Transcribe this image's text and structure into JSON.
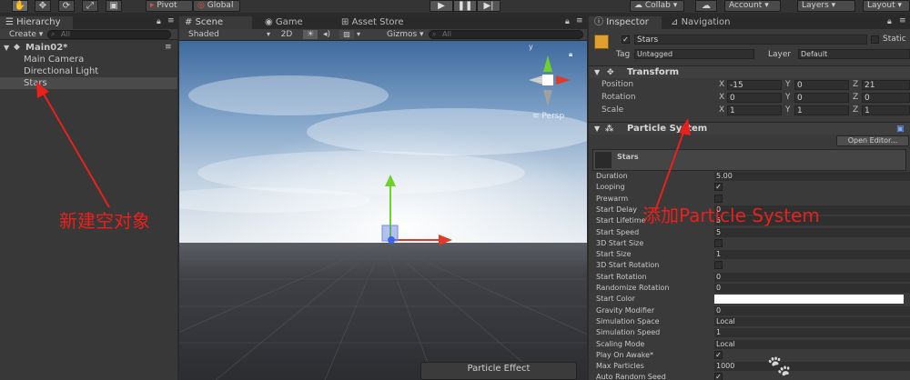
{
  "toolbar": {
    "pivot": "Pivot",
    "global": "Global",
    "collab": "Collab",
    "account": "Account",
    "layers": "Layers",
    "layout": "Layout",
    "hand_icon": "hand-icon",
    "move_icon": "move-icon",
    "rotate_icon": "rotate-icon",
    "scale_icon": "scale-icon",
    "rect_icon": "rect-icon"
  },
  "hierarchy": {
    "tab": "Hierarchy",
    "create": "Create",
    "search_placeholder": "All",
    "scene_name": "Main02*",
    "items": [
      "Main Camera",
      "Directional Light",
      "Stars"
    ],
    "selected": "Stars"
  },
  "scene": {
    "tabs": [
      "Scene",
      "Game",
      "Asset Store"
    ],
    "shading": "Shaded",
    "mode_2d": "2D",
    "gizmos": "Gizmos",
    "search_placeholder": "All",
    "persp_label": "Persp",
    "particle_effect": "Particle Effect"
  },
  "inspector": {
    "tabs": [
      "Inspector",
      "Navigation"
    ],
    "object_name": "Stars",
    "static_label": "Static",
    "tag_label": "Tag",
    "tag_value": "Untagged",
    "layer_label": "Layer",
    "layer_value": "Default",
    "transform": {
      "title": "Transform",
      "position": {
        "label": "Position",
        "x": "-15",
        "y": "0",
        "z": "21"
      },
      "rotation": {
        "label": "Rotation",
        "x": "0",
        "y": "0",
        "z": "0"
      },
      "scale": {
        "label": "Scale",
        "x": "1",
        "y": "1",
        "z": "1"
      }
    },
    "particle_system": {
      "title": "Particle System",
      "open_editor": "Open Editor...",
      "module_name": "Stars",
      "props": [
        {
          "label": "Duration",
          "value": "5.00"
        },
        {
          "label": "Looping",
          "check": true
        },
        {
          "label": "Prewarm",
          "check": false
        },
        {
          "label": "Start Delay",
          "value": "0"
        },
        {
          "label": "Start Lifetime",
          "value": "5"
        },
        {
          "label": "Start Speed",
          "value": "5"
        },
        {
          "label": "3D Start Size",
          "check": false
        },
        {
          "label": "Start Size",
          "value": "1"
        },
        {
          "label": "3D Start Rotation",
          "check": false
        },
        {
          "label": "Start Rotation",
          "value": "0"
        },
        {
          "label": "Randomize Rotation",
          "value": "0"
        },
        {
          "label": "Start Color",
          "color": "#ffffff"
        },
        {
          "label": "Gravity Modifier",
          "value": "0"
        },
        {
          "label": "Simulation Space",
          "value": "Local"
        },
        {
          "label": "Simulation Speed",
          "value": "1"
        },
        {
          "label": "Scaling Mode",
          "value": "Local"
        },
        {
          "label": "Play On Awake*",
          "check": true
        },
        {
          "label": "Max Particles",
          "value": "1000"
        },
        {
          "label": "Auto Random Seed",
          "check": true
        }
      ]
    }
  },
  "annotations": {
    "left": "新建空对象",
    "right": "添加Particle System",
    "color": "#e8211d"
  }
}
